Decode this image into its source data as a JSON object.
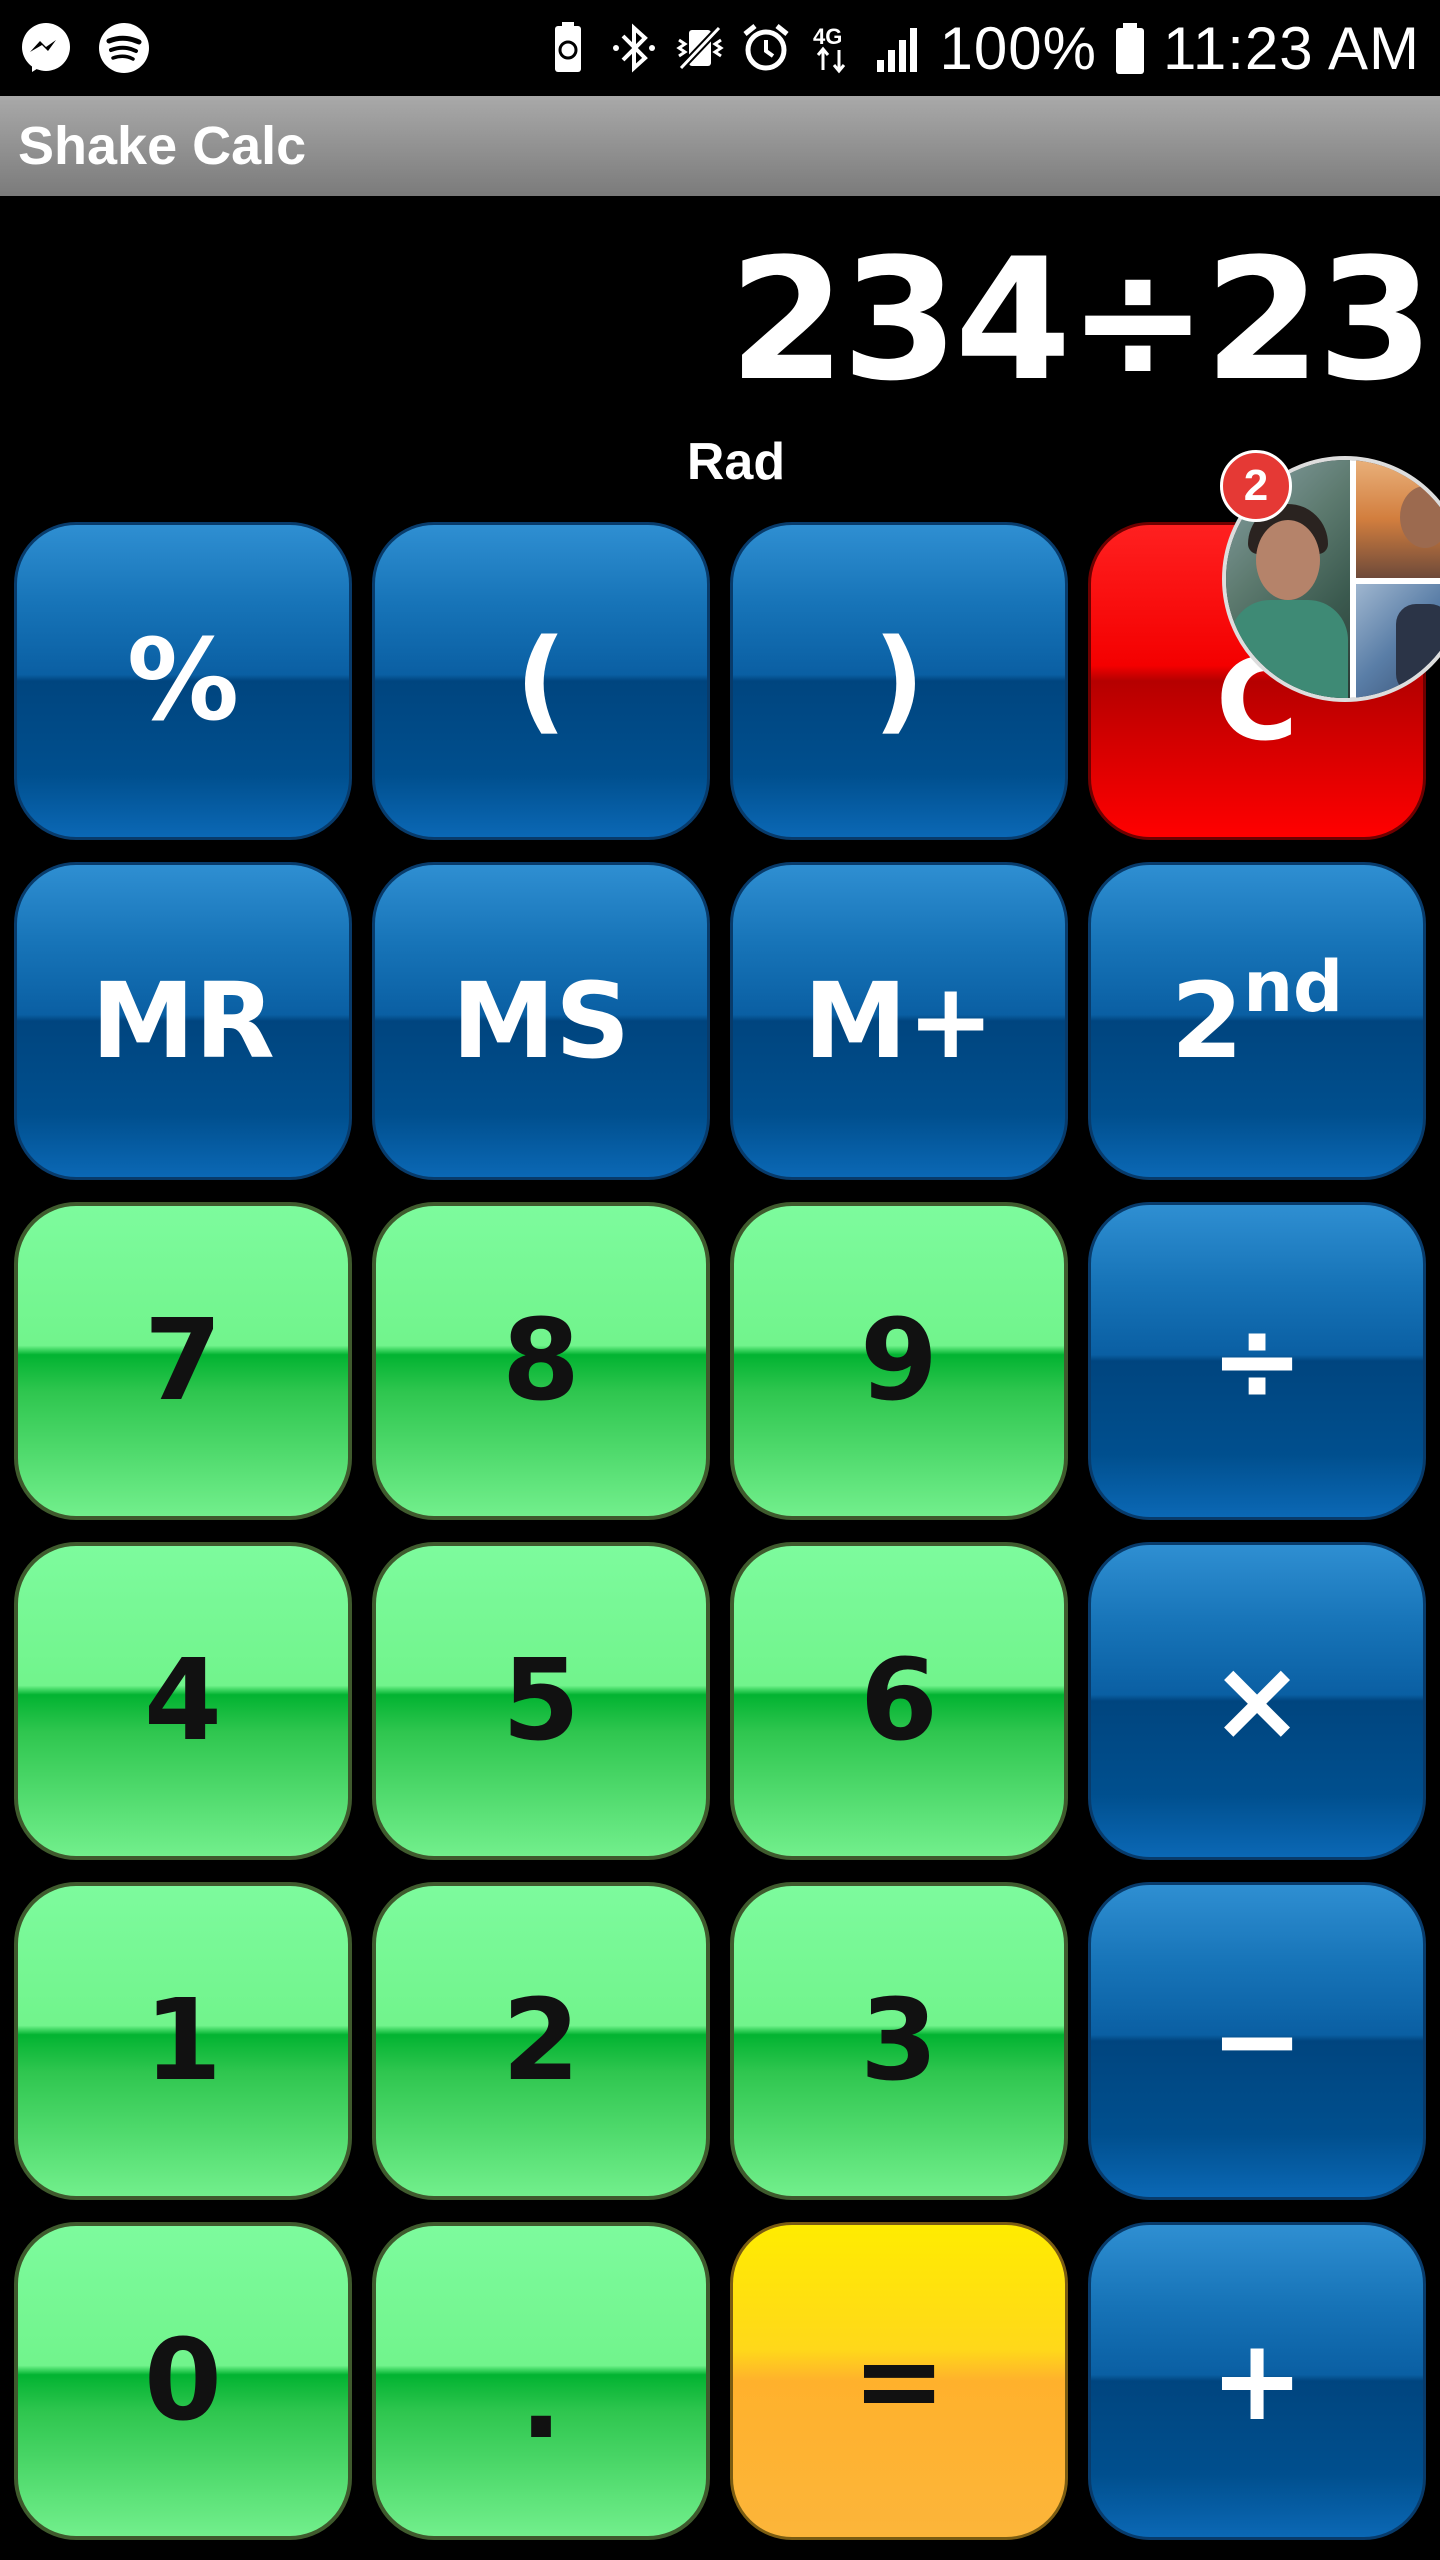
{
  "status_bar": {
    "left_icons": [
      "messenger-icon",
      "spotify-icon"
    ],
    "right_icons": [
      "battery-saver-icon",
      "bluetooth-icon",
      "vibrate-icon",
      "alarm-icon",
      "4g-icon",
      "signal-icon"
    ],
    "battery": "100%",
    "time": "11:23 AM"
  },
  "app": {
    "title": "Shake Calc"
  },
  "display": {
    "expression": "234÷23",
    "mode": "Rad"
  },
  "chat_head": {
    "badge_count": "2"
  },
  "keys": {
    "percent": "%",
    "open_paren": "(",
    "close_paren": ")",
    "clear": "C",
    "mr": "MR",
    "ms": "MS",
    "m_plus": "M+",
    "second_base": "2",
    "second_sup": "nd",
    "seven": "7",
    "eight": "8",
    "nine": "9",
    "divide": "÷",
    "four": "4",
    "five": "5",
    "six": "6",
    "multiply": "×",
    "one": "1",
    "two": "2",
    "three": "3",
    "minus": "−",
    "zero": "0",
    "dot": ".",
    "equals": "=",
    "plus": "+"
  },
  "colors": {
    "number_key": "#71f48c",
    "function_key": "#0a5fa3",
    "clear_key": "#f40000",
    "equals_key": "#ffd81a"
  }
}
